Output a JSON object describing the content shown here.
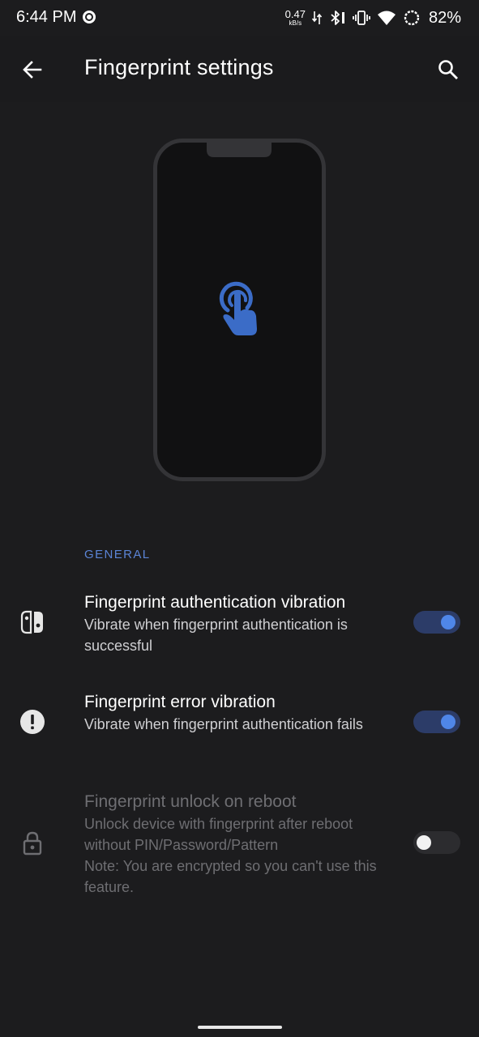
{
  "status_bar": {
    "time": "6:44 PM",
    "net_speed_value": "0.47",
    "net_speed_unit": "kB/s",
    "battery": "82%",
    "icons": [
      "media-circle-icon",
      "data-arrows-icon",
      "bluetooth-icon",
      "vibrate-icon",
      "wifi-icon",
      "battery-ring-icon"
    ]
  },
  "app_bar": {
    "title": "Fingerprint settings",
    "back_icon": "arrow-back-icon",
    "search_icon": "search-icon"
  },
  "illustration": {
    "icon": "touch-fingerprint-icon",
    "accent": "#3b6cc7"
  },
  "section": {
    "header": "GENERAL",
    "accent": "#5b84d6"
  },
  "settings": [
    {
      "icon": "controller-icon",
      "title": "Fingerprint authentication vibration",
      "summary": "Vibrate when fingerprint authentication is successful",
      "enabled": true,
      "checked": true
    },
    {
      "icon": "alert-circle-icon",
      "title": "Fingerprint error vibration",
      "summary": "Vibrate when fingerprint authentication fails",
      "enabled": true,
      "checked": true
    },
    {
      "icon": "lock-icon",
      "title": "Fingerprint unlock on reboot",
      "summary": "Unlock device with fingerprint after reboot without PIN/Password/Pattern",
      "note": "Note: You are encrypted so you can't use this feature.",
      "enabled": false,
      "checked": false
    }
  ],
  "colors": {
    "background": "#1c1c1e",
    "toggle_on_track": "#2c3c68",
    "toggle_on_thumb": "#4f86e8",
    "toggle_off_thumb": "#f2f2f2",
    "disabled_text": "#6e6e72"
  }
}
